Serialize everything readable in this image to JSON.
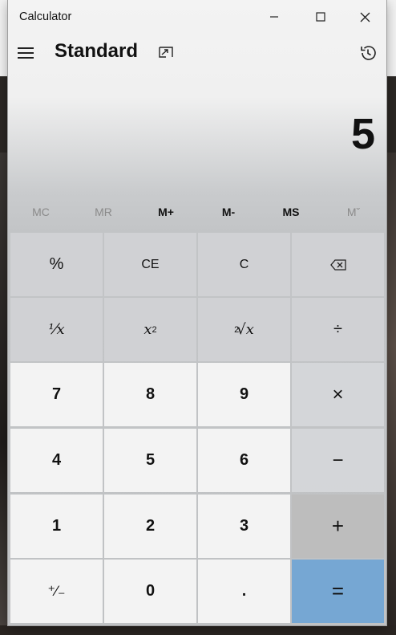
{
  "window": {
    "title": "Calculator"
  },
  "header": {
    "mode": "Standard"
  },
  "display": {
    "value": "5"
  },
  "memory": [
    "MC",
    "MR",
    "M+",
    "M-",
    "MS",
    "Mˇ"
  ],
  "memory_enabled": [
    false,
    false,
    true,
    true,
    true,
    false
  ],
  "keys": {
    "percent": "%",
    "ce": "CE",
    "clear": "C",
    "backspace": "⌫",
    "reciprocal": "⅟x",
    "square_base": "x",
    "square_exp": "2",
    "sqrt_index": "2",
    "sqrt_sym": "√x",
    "divide": "÷",
    "seven": "7",
    "eight": "8",
    "nine": "9",
    "multiply": "×",
    "four": "4",
    "five": "5",
    "six": "6",
    "minus": "−",
    "one": "1",
    "two": "2",
    "three": "3",
    "plus": "+",
    "negate": "⁺∕₋",
    "zero": "0",
    "decimal": ".",
    "equals": "="
  },
  "icons": {
    "menu": "hamburger-icon",
    "keep_on_top": "keep-on-top-icon",
    "history": "history-icon",
    "minimize": "minimize-icon",
    "maximize": "maximize-icon",
    "close": "close-icon"
  },
  "colors": {
    "equals_key": "#76a7d3",
    "plus_key": "#bdbdbd"
  }
}
